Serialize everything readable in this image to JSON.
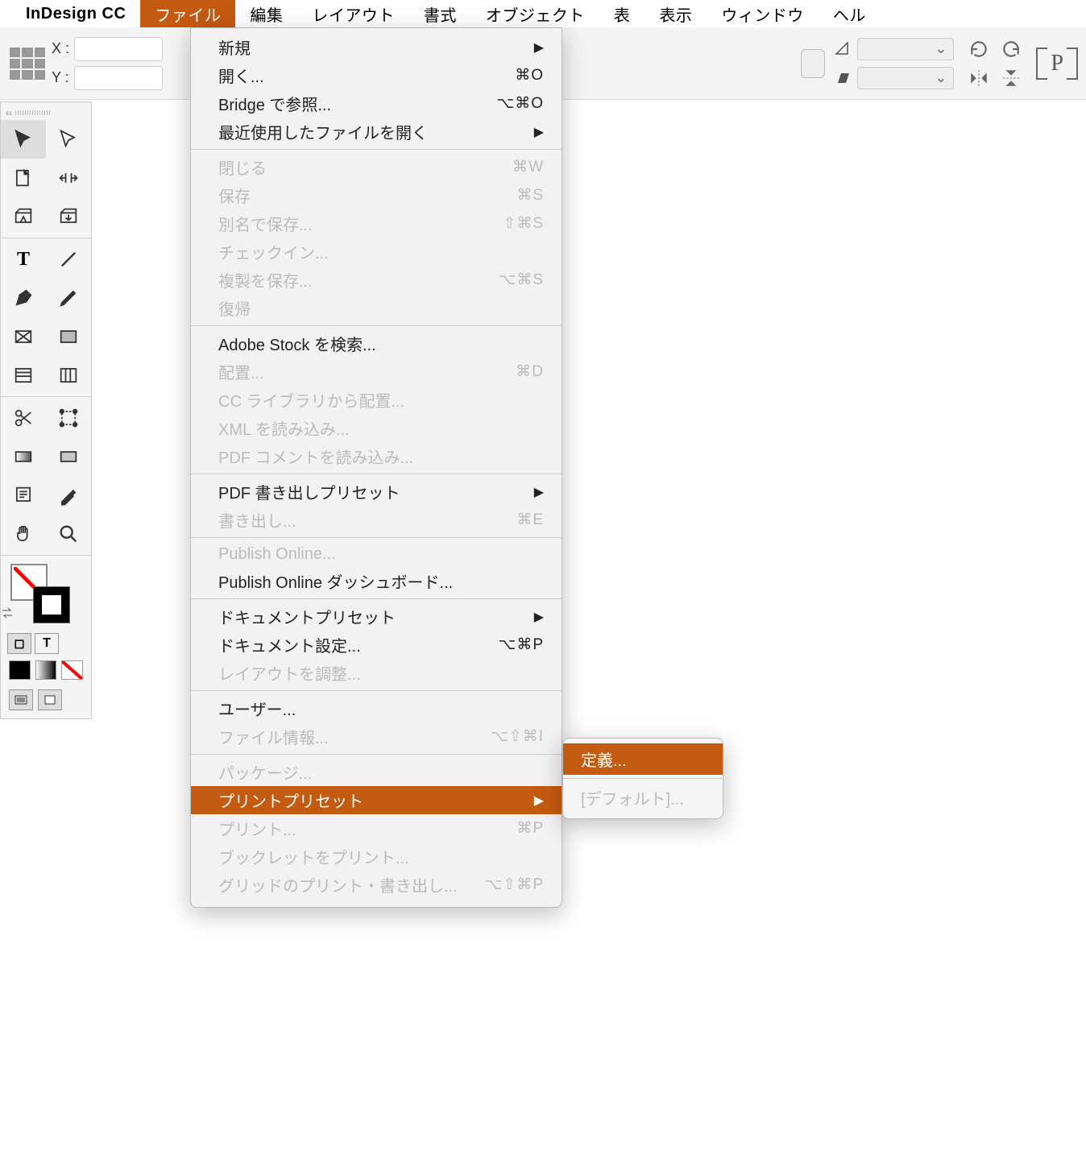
{
  "menubar": {
    "app_name": "InDesign CC",
    "items": [
      "ファイル",
      "編集",
      "レイアウト",
      "書式",
      "オブジェクト",
      "表",
      "表示",
      "ウィンドウ",
      "ヘル"
    ]
  },
  "control_bar": {
    "x_label": "X :",
    "y_label": "Y :"
  },
  "file_menu": {
    "groups": [
      [
        {
          "label": "新規",
          "arrow": true
        },
        {
          "label": "開く...",
          "shortcut": "⌘O"
        },
        {
          "label": "Bridge で参照...",
          "shortcut": "⌥⌘O"
        },
        {
          "label": "最近使用したファイルを開く",
          "arrow": true
        }
      ],
      [
        {
          "label": "閉じる",
          "shortcut": "⌘W",
          "disabled": true
        },
        {
          "label": "保存",
          "shortcut": "⌘S",
          "disabled": true
        },
        {
          "label": "別名で保存...",
          "shortcut": "⇧⌘S",
          "disabled": true
        },
        {
          "label": "チェックイン...",
          "disabled": true
        },
        {
          "label": "複製を保存...",
          "shortcut": "⌥⌘S",
          "disabled": true
        },
        {
          "label": "復帰",
          "disabled": true
        }
      ],
      [
        {
          "label": "Adobe Stock を検索..."
        },
        {
          "label": "配置...",
          "shortcut": "⌘D",
          "disabled": true
        },
        {
          "label": "CC ライブラリから配置...",
          "disabled": true
        },
        {
          "label": "XML を読み込み...",
          "disabled": true
        },
        {
          "label": "PDF コメントを読み込み...",
          "disabled": true
        }
      ],
      [
        {
          "label": "PDF 書き出しプリセット",
          "arrow": true
        },
        {
          "label": "書き出し...",
          "shortcut": "⌘E",
          "disabled": true
        }
      ],
      [
        {
          "label": "Publish Online...",
          "disabled": true
        },
        {
          "label": "Publish Online ダッシュボード..."
        }
      ],
      [
        {
          "label": "ドキュメントプリセット",
          "arrow": true
        },
        {
          "label": "ドキュメント設定...",
          "shortcut": "⌥⌘P"
        },
        {
          "label": "レイアウトを調整...",
          "disabled": true
        }
      ],
      [
        {
          "label": "ユーザー..."
        },
        {
          "label": "ファイル情報...",
          "shortcut": "⌥⇧⌘I",
          "disabled": true
        }
      ],
      [
        {
          "label": "パッケージ...",
          "disabled": true
        },
        {
          "label": "プリントプリセット",
          "arrow": true,
          "highlighted": true
        },
        {
          "label": "プリント...",
          "shortcut": "⌘P",
          "disabled": true
        },
        {
          "label": "ブックレットをプリント...",
          "disabled": true
        },
        {
          "label": "グリッドのプリント・書き出し...",
          "shortcut": "⌥⇧⌘P",
          "disabled": true
        }
      ]
    ]
  },
  "submenu": {
    "define": "定義...",
    "default": "[デフォルト]..."
  }
}
